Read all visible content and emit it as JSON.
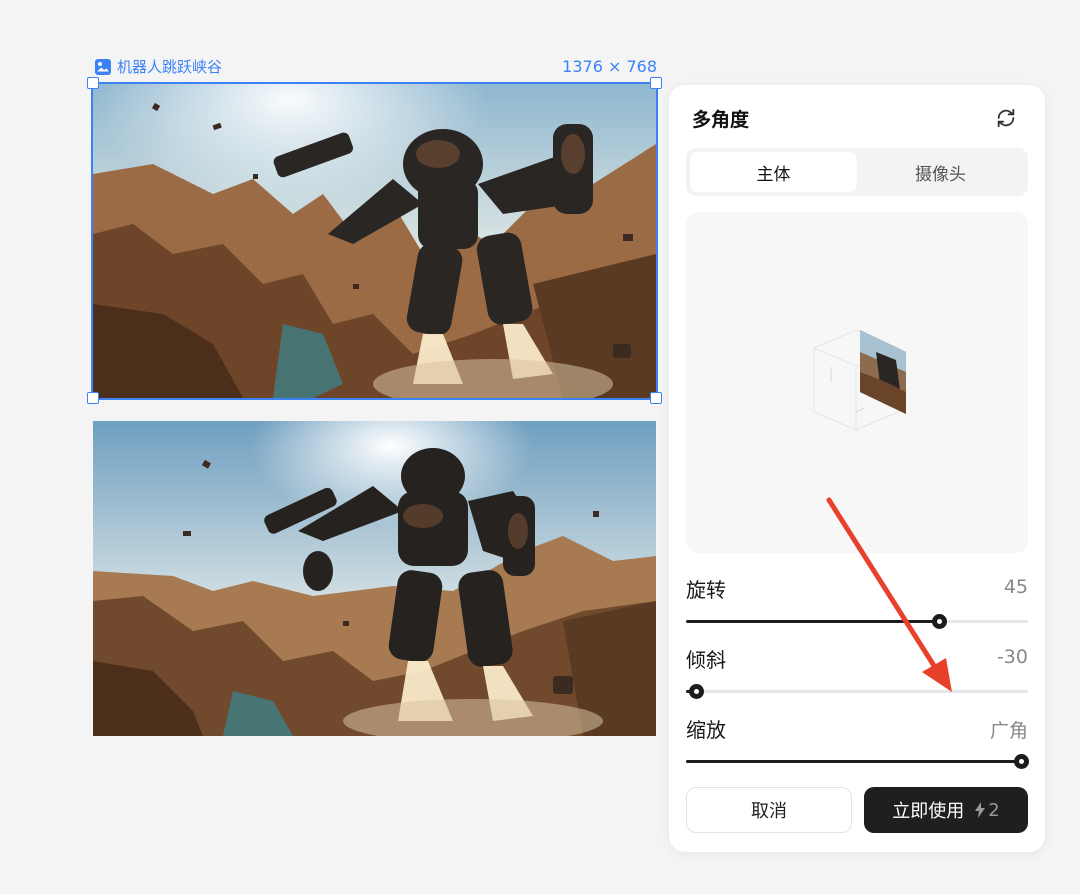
{
  "canvas": {
    "image_title": "机器人跳跃峡谷",
    "image_size": "1376 × 768",
    "image_icon": "image-icon"
  },
  "panel": {
    "title": "多角度",
    "refresh_icon": "refresh-icon",
    "tabs": [
      {
        "label": "主体",
        "active": true
      },
      {
        "label": "摄像头",
        "active": false
      }
    ],
    "controls": [
      {
        "label": "旋转",
        "value": "45",
        "level": 0.74
      },
      {
        "label": "倾斜",
        "value": "-30",
        "level": 0.03
      },
      {
        "label": "缩放",
        "value": "广角",
        "level": 0.98
      }
    ],
    "cancel_label": "取消",
    "apply_label": "立即使用",
    "cost_value": "2",
    "cost_icon": "lightning-icon"
  },
  "colors": {
    "accent": "#3b82f6",
    "primary_button": "#1f1f1f",
    "annotation_arrow": "#e8412b"
  }
}
